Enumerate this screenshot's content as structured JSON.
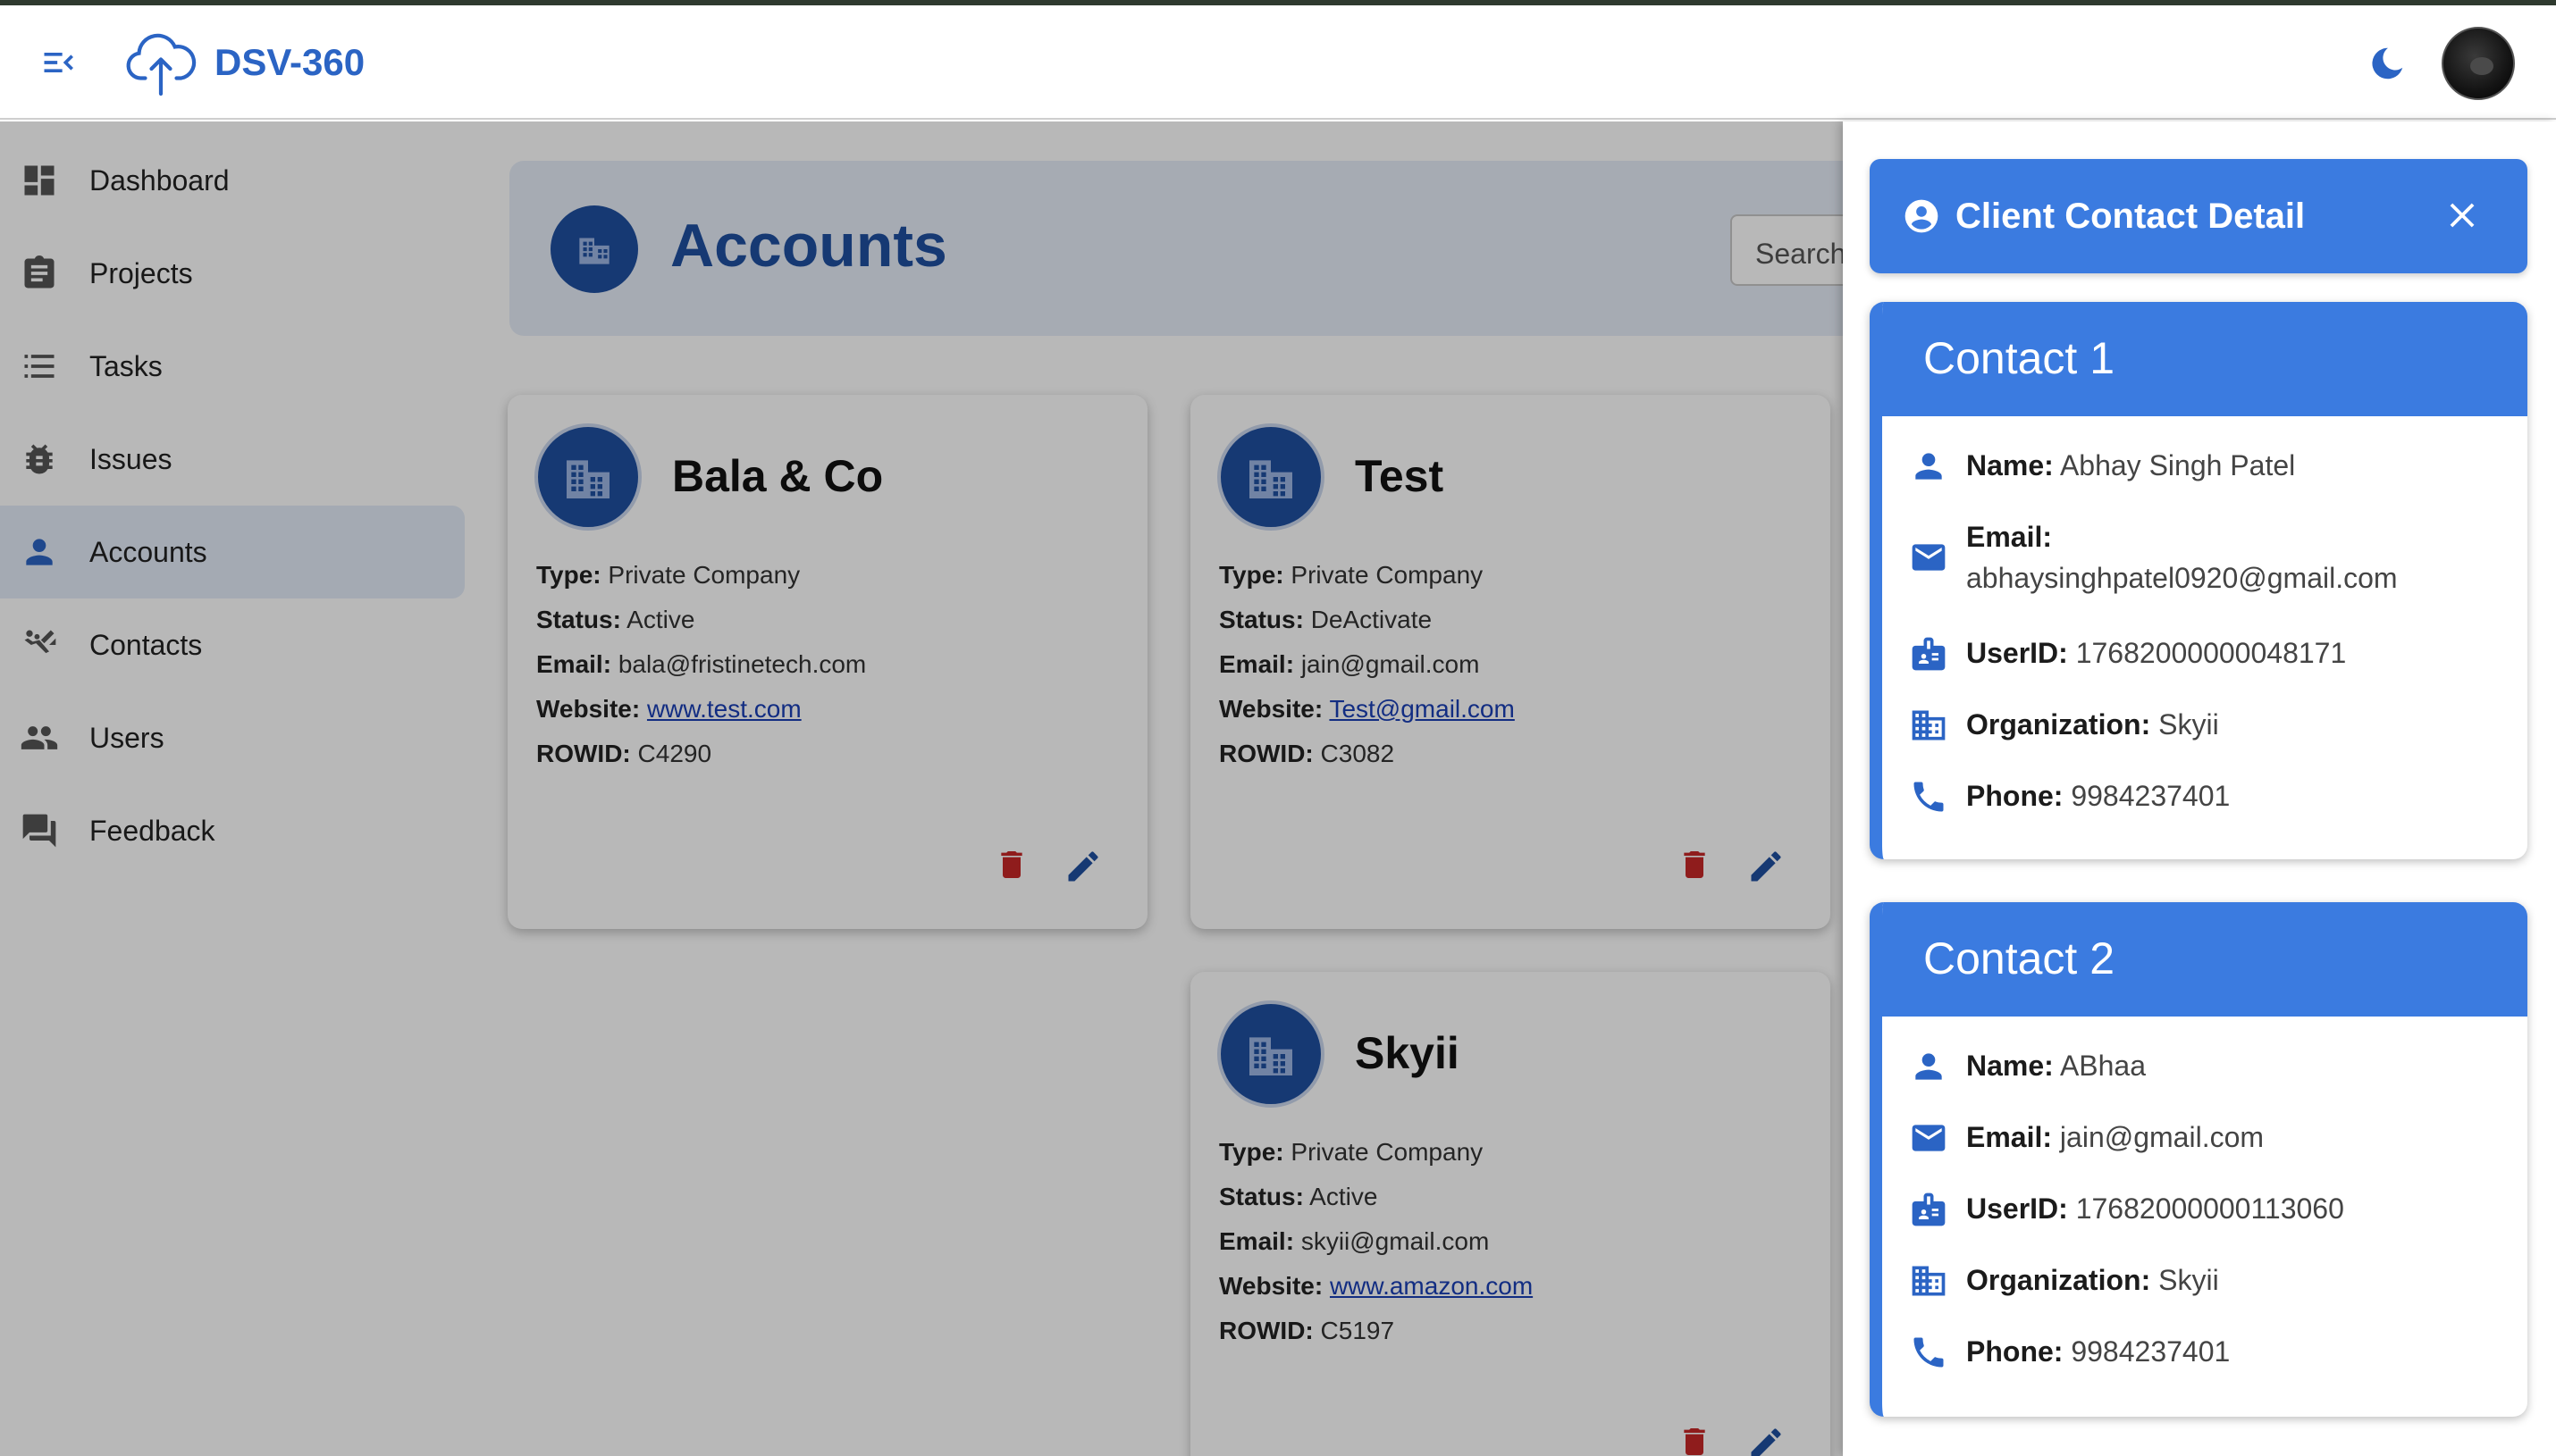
{
  "app": {
    "brand": "DSV-360"
  },
  "sidebar": {
    "items": [
      {
        "label": "Dashboard",
        "icon": "dashboard-icon"
      },
      {
        "label": "Projects",
        "icon": "clipboard-icon"
      },
      {
        "label": "Tasks",
        "icon": "list-icon"
      },
      {
        "label": "Issues",
        "icon": "bug-icon"
      },
      {
        "label": "Accounts",
        "icon": "person-icon",
        "active": true
      },
      {
        "label": "Contacts",
        "icon": "contacts-icon"
      },
      {
        "label": "Users",
        "icon": "users-icon"
      },
      {
        "label": "Feedback",
        "icon": "feedback-icon"
      }
    ]
  },
  "page": {
    "title": "Accounts",
    "search_placeholder": "Search"
  },
  "labels": {
    "type": "Type:",
    "status": "Status:",
    "email": "Email:",
    "website": "Website:",
    "rowid": "ROWID:"
  },
  "accounts": [
    {
      "name": "Bala & Co",
      "type": "Private Company",
      "status": "Active",
      "email": "bala@fristinetech.com",
      "website": "www.test.com",
      "rowid": "C4290"
    },
    {
      "name": "Test",
      "type": "Private Company",
      "status": "DeActivate",
      "email": "jain@gmail.com",
      "website": "Test@gmail.com",
      "rowid": "C3082"
    },
    {
      "name": "Skyii",
      "type": "Private Company",
      "status": "Active",
      "email": "skyii@gmail.com",
      "website": "www.amazon.com",
      "rowid": "C5197"
    }
  ],
  "drawer": {
    "title": "Client Contact Detail",
    "labels": {
      "name": "Name:",
      "email": "Email:",
      "userid": "UserID:",
      "organization": "Organization:",
      "phone": "Phone:"
    },
    "contacts": [
      {
        "heading": "Contact 1",
        "name": "Abhay Singh Patel",
        "email": "abhaysinghpatel0920@gmail.com",
        "userid": "17682000000048171",
        "organization": "Skyii",
        "phone": "9984237401"
      },
      {
        "heading": "Contact 2",
        "name": "ABhaa",
        "email": "jain@gmail.com",
        "userid": "17682000000113060",
        "organization": "Skyii",
        "phone": "9984237401"
      }
    ]
  },
  "colors": {
    "accent": "#3b7be0",
    "brand": "#2b64c4",
    "delete": "#c62828",
    "edit": "#1f4fa0"
  }
}
